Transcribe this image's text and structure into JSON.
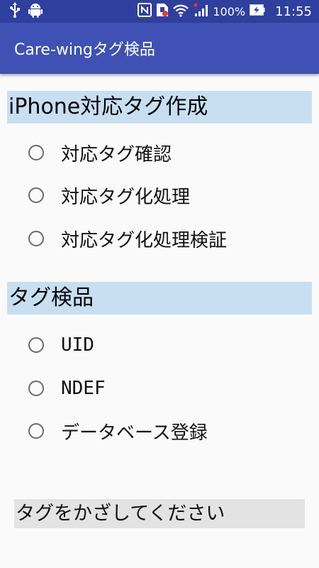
{
  "status_bar": {
    "left_icons": [
      "usb-icon",
      "android-icon"
    ],
    "right_icons": [
      "nfc-icon",
      "sim-alert-icon",
      "wifi-icon",
      "signal-icon",
      "battery-icon"
    ],
    "battery": "100%",
    "time": "11:55"
  },
  "app_bar": {
    "title": "Care-wingタグ検品",
    "background_color": "#3f51b5"
  },
  "sections": [
    {
      "header": "iPhone対応タグ作成",
      "options": [
        {
          "label": "対応タグ確認",
          "selected": false
        },
        {
          "label": "対応タグ化処理",
          "selected": false
        },
        {
          "label": "対応タグ化処理検証",
          "selected": false
        }
      ]
    },
    {
      "header": "タグ検品",
      "options": [
        {
          "label": "UID",
          "selected": false
        },
        {
          "label": "NDEF",
          "selected": false
        },
        {
          "label": "データベース登録",
          "selected": false
        }
      ]
    }
  ],
  "message": "タグをかざしてください",
  "colors": {
    "section_header_bg": "#c8dff2",
    "message_bg": "#e3e3e3",
    "status_bar": "#2f3f9e"
  }
}
